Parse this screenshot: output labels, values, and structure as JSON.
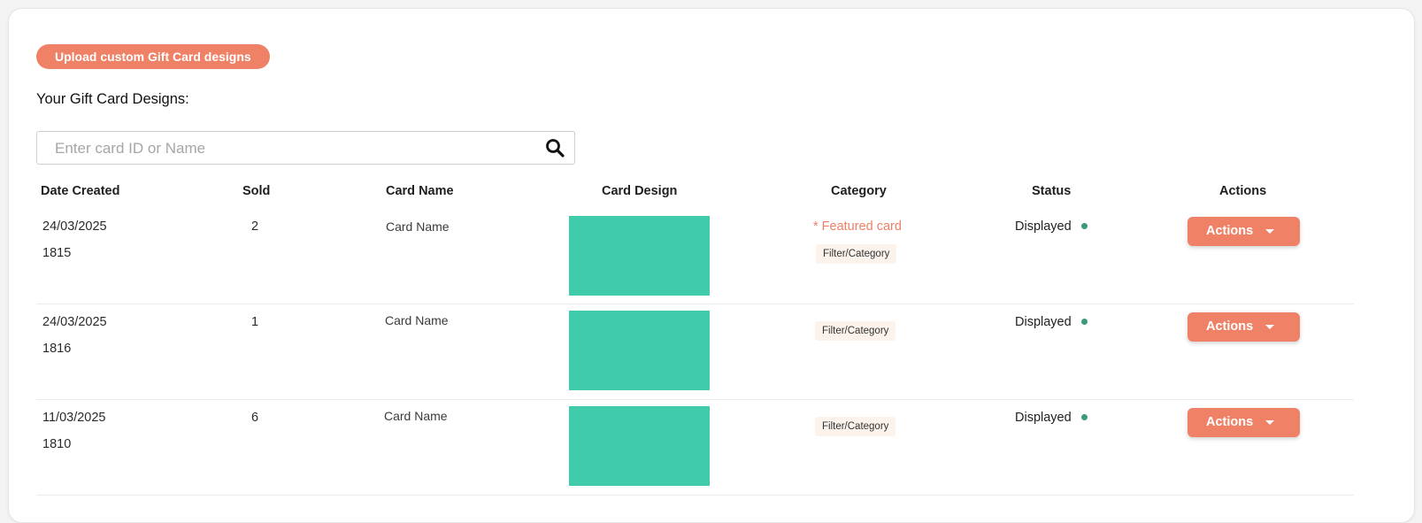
{
  "upload_button": "Upload custom Gift Card designs",
  "section_title": "Your Gift Card Designs:",
  "search": {
    "placeholder": "Enter card ID or Name",
    "value": ""
  },
  "columns": {
    "date_created": "Date Created",
    "sold": "Sold",
    "card_name": "Card Name",
    "card_design": "Card Design",
    "category": "Category",
    "status": "Status",
    "actions": "Actions"
  },
  "rows": [
    {
      "date": "24/03/2025",
      "id": "1815",
      "sold": "2",
      "card_name": "Card Name",
      "featured": "* Featured card",
      "category": "Filter/Category",
      "status": "Displayed",
      "action_label": "Actions"
    },
    {
      "date": "24/03/2025",
      "id": "1816",
      "sold": "1",
      "card_name": "Card Name",
      "featured": "",
      "category": "Filter/Category",
      "status": "Displayed",
      "action_label": "Actions"
    },
    {
      "date": "11/03/2025",
      "id": "1810",
      "sold": "6",
      "card_name": "Card Name",
      "featured": "",
      "category": "Filter/Category",
      "status": "Displayed",
      "action_label": "Actions"
    }
  ],
  "colors": {
    "accent": "#ee8166",
    "card_design": "#40cbab",
    "status_displayed": "#3b9a77",
    "tag_background": "#fbf3ec"
  },
  "icons": {
    "search": "search-icon",
    "dropdown": "caret-down-icon",
    "status": "status-dot-icon"
  }
}
